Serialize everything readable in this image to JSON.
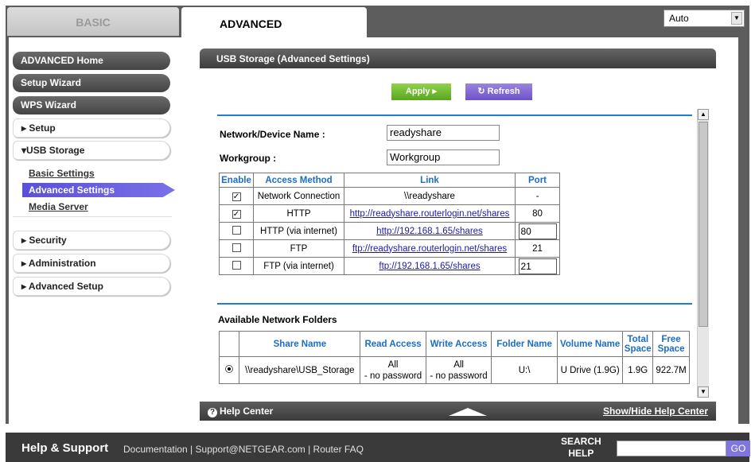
{
  "tabs": {
    "basic": "BASIC",
    "advanced": "ADVANCED"
  },
  "language": {
    "selected": "Auto"
  },
  "sidebar": {
    "dark_items": [
      "ADVANCED Home",
      "Setup Wizard",
      "WPS Wizard"
    ],
    "setup": "▸ Setup",
    "usb_storage": "▾USB Storage",
    "usb_sub": {
      "basic": "Basic Settings",
      "advanced": "Advanced Settings",
      "media": "Media Server"
    },
    "security": "▸ Security",
    "administration": "▸ Administration",
    "advanced_setup": "▸ Advanced Setup"
  },
  "panel": {
    "title": "USB Storage (Advanced Settings)",
    "apply_label": "Apply ▸",
    "refresh_label": "↻ Refresh",
    "network_name_label": "Network/Device Name :",
    "network_name_value": "readyshare",
    "workgroup_label": "Workgroup :",
    "workgroup_value": "Workgroup"
  },
  "access_table": {
    "headers": [
      "Enable",
      "Access Method",
      "Link",
      "Port"
    ],
    "rows": [
      {
        "checked": true,
        "method": "Network Connection",
        "link": "\\\\readyshare",
        "link_is_url": false,
        "port": "-",
        "port_editable": false
      },
      {
        "checked": true,
        "method": "HTTP",
        "link": "http://readyshare.routerlogin.net/shares",
        "link_is_url": true,
        "port": "80",
        "port_editable": false
      },
      {
        "checked": false,
        "method": "HTTP (via internet)",
        "link": "http://192.168.1.65/shares",
        "link_is_url": true,
        "port": "80",
        "port_editable": true
      },
      {
        "checked": false,
        "method": "FTP",
        "link": "ftp://readyshare.routerlogin.net/shares",
        "link_is_url": true,
        "port": "21",
        "port_editable": false
      },
      {
        "checked": false,
        "method": "FTP (via internet)",
        "link": "ftp://192.168.1.65/shares",
        "link_is_url": true,
        "port": "21",
        "port_editable": true
      }
    ]
  },
  "folders": {
    "title": "Available Network Folders",
    "headers": [
      "",
      "Share Name",
      "Read Access",
      "Write Access",
      "Folder Name",
      "Volume Name",
      "Total Space",
      "Free Space"
    ],
    "rows": [
      {
        "share": "\\\\readyshare\\USB_Storage",
        "read": "All\n- no password",
        "write": "All\n- no password",
        "folder": "U:\\",
        "volume": "U Drive (1.9G)",
        "total": "1.9G",
        "free": "922.7M"
      }
    ]
  },
  "panel_footer": {
    "help_center": "Help Center",
    "show_hide": "Show/Hide Help Center"
  },
  "footer": {
    "title": "Help & Support",
    "links": [
      "Documentation",
      "Support@NETGEAR.com",
      "Router FAQ"
    ],
    "search_label_1": "SEARCH",
    "search_label_2": "HELP",
    "go": "GO"
  },
  "colors": {
    "accent_blue": "#1e7fd0",
    "apply_green": "#6ab52c",
    "refresh_purple": "#7a60d0",
    "dark_bar": "#444444"
  }
}
